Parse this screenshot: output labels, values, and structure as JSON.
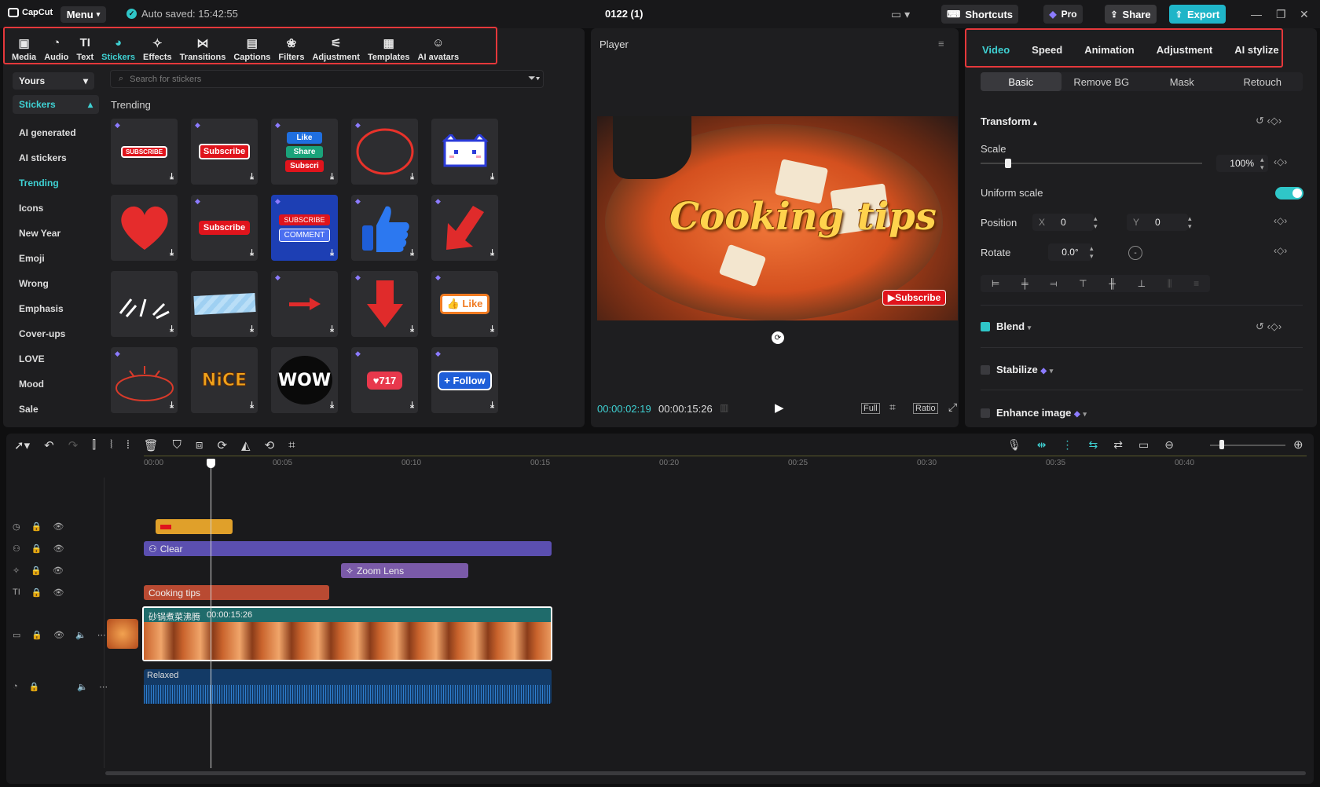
{
  "app": {
    "logo": "CapCut",
    "menu": "Menu",
    "autosave": "Auto saved: 15:42:55",
    "project_title": "0122 (1)"
  },
  "topbar": {
    "shortcuts": "Shortcuts",
    "pro": "Pro",
    "share": "Share",
    "export": "Export"
  },
  "tools": [
    {
      "label": "Media",
      "icon": "media-icon"
    },
    {
      "label": "Audio",
      "icon": "audio-icon"
    },
    {
      "label": "Text",
      "icon": "text-icon"
    },
    {
      "label": "Stickers",
      "icon": "stickers-icon"
    },
    {
      "label": "Effects",
      "icon": "effects-icon"
    },
    {
      "label": "Transitions",
      "icon": "transitions-icon"
    },
    {
      "label": "Captions",
      "icon": "captions-icon"
    },
    {
      "label": "Filters",
      "icon": "filters-icon"
    },
    {
      "label": "Adjustment",
      "icon": "adjustment-icon"
    },
    {
      "label": "Templates",
      "icon": "templates-icon"
    },
    {
      "label": "AI avatars",
      "icon": "ai-avatars-icon"
    }
  ],
  "stickers_panel": {
    "dropdown": "Yours",
    "search_placeholder": "Search for stickers",
    "section_title": "Trending",
    "categories": [
      "Stickers",
      "AI generated",
      "AI stickers",
      "Trending",
      "Icons",
      "New Year",
      "Emoji",
      "Wrong",
      "Emphasis",
      "Cover-ups",
      "LOVE",
      "Mood",
      "Sale"
    ],
    "sticker_texts": {
      "subscribe_small": "SUBSCRIBE",
      "subscribe": "Subscribe",
      "like": "Like",
      "share": "Share",
      "subscri": "Subscri",
      "subscribe_caps": "SUBSCRIBE",
      "comment": "COMMENT",
      "like2": "Like",
      "nice": "NiCE",
      "wow": "WOW",
      "count": "717",
      "follow": "Follow"
    }
  },
  "player": {
    "title": "Player",
    "overlay_text": "Cooking tips",
    "sticker": "Subscribe",
    "current_time": "00:00:02:19",
    "duration": "00:00:15:26",
    "buttons": {
      "full": "Full",
      "ratio": "Ratio"
    }
  },
  "inspector": {
    "tabs": [
      "Video",
      "Speed",
      "Animation",
      "Adjustment",
      "AI stylize"
    ],
    "subtabs": [
      "Basic",
      "Remove BG",
      "Mask",
      "Retouch"
    ],
    "transform": "Transform",
    "scale_label": "Scale",
    "scale_value": "100%",
    "scale_fraction": 0.11,
    "uniform_scale": "Uniform scale",
    "position_label": "Position",
    "pos_x_label": "X",
    "pos_x": "0",
    "pos_y_label": "Y",
    "pos_y": "0",
    "rotate_label": "Rotate",
    "rotate_value": "0.0°",
    "blend": "Blend",
    "stabilize": "Stabilize",
    "enhance": "Enhance image"
  },
  "timeline": {
    "ruler": [
      "00:00",
      "00:05",
      "00:10",
      "00:15",
      "00:20",
      "00:25",
      "00:30",
      "00:35",
      "00:40"
    ],
    "clips": {
      "effect_clip": "Clear",
      "zoom": "Zoom Lens",
      "text": "Cooking tips",
      "video_name": "砂锅煮菜沸腾",
      "video_duration": "00:00:15:26",
      "audio": "Relaxed"
    }
  },
  "colors": {
    "accent": "#3fd1d3",
    "highlight": "#e5383b",
    "export": "#1fb5c8",
    "effect_clip": "#5b4fb0",
    "text_clip": "#b94a32"
  }
}
